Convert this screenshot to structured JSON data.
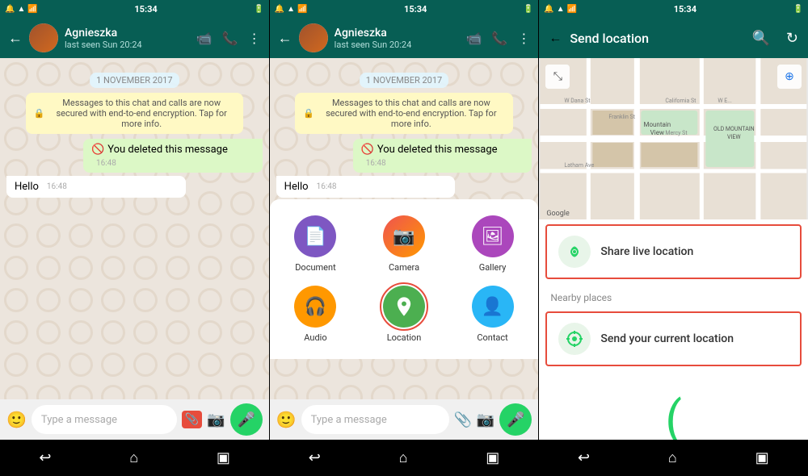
{
  "screens": [
    {
      "id": "screen1",
      "statusBar": {
        "left": "🔔 📶",
        "time": "15:34",
        "right": "📶 🔋"
      },
      "header": {
        "contactName": "Agnieszka",
        "lastSeen": "last seen Sun 20:24"
      },
      "chat": {
        "dateBadge": "1 NOVEMBER 2017",
        "systemMsg": "Messages to this chat and calls are now secured with end-to-end encryption. Tap for more info.",
        "deletedMsg": "You deleted this message",
        "deletedTime": "16:48",
        "helloMsg": "Hello",
        "helloTime": "16:48"
      },
      "inputBar": {
        "placeholder": "Type a message",
        "attachHighlighted": true
      }
    },
    {
      "id": "screen2",
      "statusBar": {
        "time": "15:34"
      },
      "header": {
        "contactName": "Agnieszka",
        "lastSeen": "last seen Sun 20:24"
      },
      "chat": {
        "dateBadge": "1 NOVEMBER 2017",
        "systemMsg": "Messages to this chat and calls are now secured with end-to-end encryption. Tap for more info.",
        "deletedMsg": "You deleted this message",
        "deletedTime": "16:48",
        "helloMsg": "Hello",
        "helloTime": "16:48"
      },
      "shareMenu": {
        "items": [
          {
            "id": "document",
            "label": "Document",
            "color": "#7e57c2",
            "icon": "📄"
          },
          {
            "id": "camera",
            "label": "Camera",
            "color": "#ef5350",
            "icon": "📷"
          },
          {
            "id": "gallery",
            "label": "Gallery",
            "color": "#ab47bc",
            "icon": "🖼"
          },
          {
            "id": "audio",
            "label": "Audio",
            "color": "#ff9800",
            "icon": "🎧"
          },
          {
            "id": "location",
            "label": "Location",
            "color": "#4caf50",
            "icon": "📍",
            "highlighted": true
          },
          {
            "id": "contact",
            "label": "Contact",
            "color": "#29b6f6",
            "icon": "👤"
          }
        ]
      },
      "inputBar": {
        "placeholder": "Type a message"
      }
    },
    {
      "id": "screen3",
      "statusBar": {
        "time": "15:34"
      },
      "header": {
        "title": "Send location"
      },
      "liveLocation": {
        "title": "Share live location",
        "highlighted": true
      },
      "nearbyLabel": "Nearby places",
      "currentLocation": {
        "title": "Send your current location",
        "highlighted": true
      }
    }
  ],
  "bottomNav": {
    "icons": [
      "↩",
      "⌂",
      "▣"
    ]
  },
  "colors": {
    "whatsappGreen": "#075e54",
    "whatsappLight": "#25d366",
    "highlight": "#e74c3c"
  }
}
